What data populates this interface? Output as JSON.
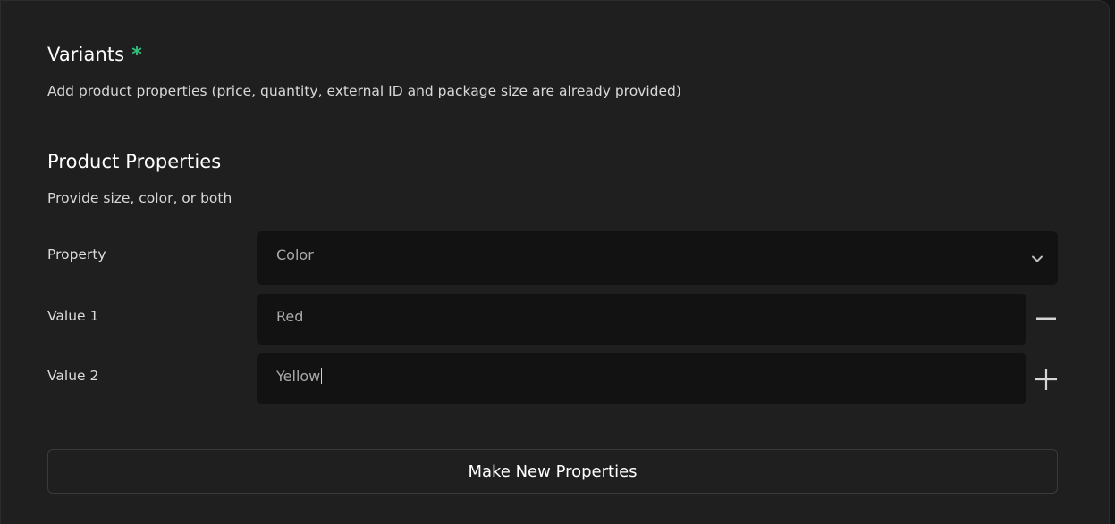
{
  "variants": {
    "title": "Variants",
    "required_marker": "*",
    "description": "Add product properties (price, quantity, external ID and package size are already provided)"
  },
  "product_properties": {
    "title": "Product Properties",
    "description": "Provide size, color, or both",
    "property": {
      "label": "Property",
      "selected": "Color"
    },
    "values": [
      {
        "label": "Value 1",
        "value": "Red",
        "action_icon": "minus-icon"
      },
      {
        "label": "Value 2",
        "value": "Yellow",
        "action_icon": "plus-icon"
      }
    ]
  },
  "actions": {
    "make_new_properties_label": "Make New Properties"
  },
  "colors": {
    "accent_required": "#2ec27e",
    "panel_bg": "#1f1f20",
    "field_bg": "#121213"
  }
}
